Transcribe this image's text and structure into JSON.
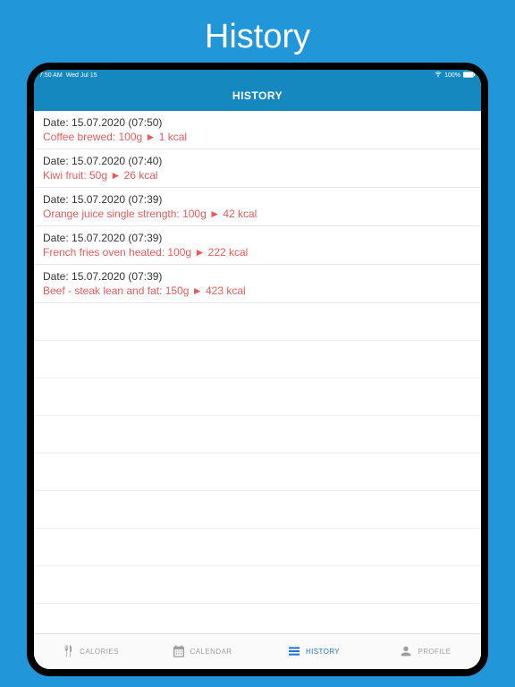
{
  "outerTitle": "History",
  "statusBar": {
    "time": "7:50 AM",
    "day": "Wed Jul 15",
    "batteryPercent": "100%"
  },
  "headerTitle": "HISTORY",
  "entries": [
    {
      "date": "Date: 15.07.2020 (07:50)",
      "detail": "Coffee brewed: 100g ►  1 kcal"
    },
    {
      "date": "Date: 15.07.2020 (07:40)",
      "detail": "Kiwi fruit:  50g ► 26 kcal"
    },
    {
      "date": "Date: 15.07.2020 (07:39)",
      "detail": "Orange juice single strength: 100g ► 42 kcal"
    },
    {
      "date": "Date: 15.07.2020 (07:39)",
      "detail": "French fries oven heated: 100g ► 222 kcal"
    },
    {
      "date": "Date: 15.07.2020 (07:39)",
      "detail": "Beef - steak lean and fat: 150g ► 423 kcal"
    }
  ],
  "tabs": {
    "calories": "CALORIES",
    "calendar": "CALENDAR",
    "history": "HISTORY",
    "profile": "PROFILE"
  },
  "colors": {
    "background": "#2196d8",
    "headerBlue": "#1588bf",
    "detailRed": "#e85a5a",
    "activeTab": "#1976d2",
    "inactiveTab": "#9e9e9e"
  }
}
